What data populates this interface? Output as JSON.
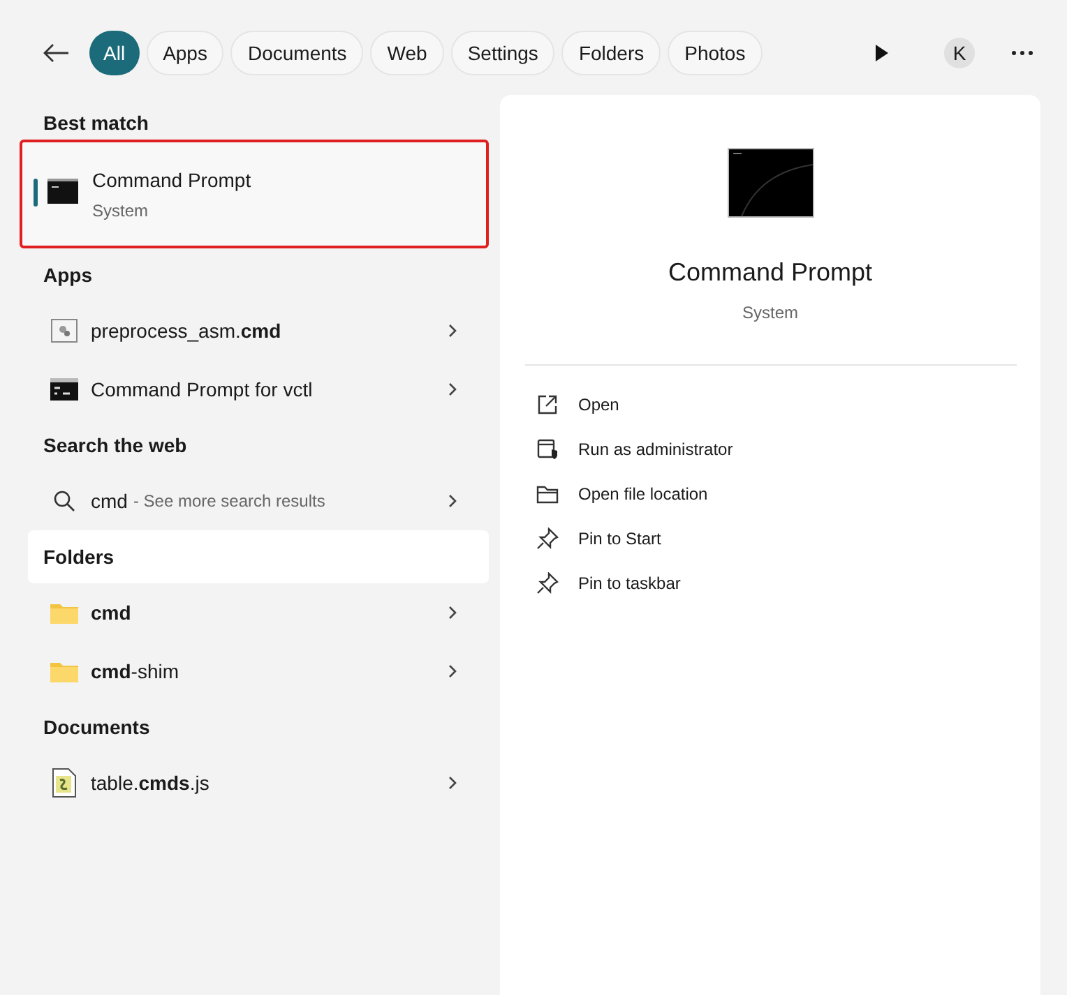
{
  "filters": [
    {
      "label": "All",
      "selected": true
    },
    {
      "label": "Apps",
      "selected": false
    },
    {
      "label": "Documents",
      "selected": false
    },
    {
      "label": "Web",
      "selected": false
    },
    {
      "label": "Settings",
      "selected": false
    },
    {
      "label": "Folders",
      "selected": false
    },
    {
      "label": "Photos",
      "selected": false
    }
  ],
  "account": {
    "initial": "K"
  },
  "best_match": {
    "heading": "Best match",
    "title": "Command Prompt",
    "subtitle": "System",
    "selected": true,
    "outlined": true
  },
  "sections": [
    {
      "heading": "Apps",
      "hovered": false,
      "items": [
        {
          "kind": "script",
          "name": "preprocess_asm.**cmd**"
        },
        {
          "kind": "console",
          "name": "Command Prompt for vctl"
        }
      ]
    },
    {
      "heading": "Search the web",
      "hovered": false,
      "items": [
        {
          "kind": "web",
          "name": "cmd",
          "hint": "- See more search results"
        }
      ]
    },
    {
      "heading": "Folders",
      "hovered": true,
      "items": [
        {
          "kind": "folder",
          "name": "**cmd**"
        },
        {
          "kind": "folder",
          "name": "**cmd**-shim"
        }
      ]
    },
    {
      "heading": "Documents",
      "hovered": false,
      "items": [
        {
          "kind": "jsfile",
          "name": "table.**cmds**.js"
        }
      ]
    }
  ],
  "preview": {
    "title": "Command Prompt",
    "subtitle": "System",
    "actions": [
      {
        "kind": "open",
        "label": "Open"
      },
      {
        "kind": "admin",
        "label": "Run as administrator"
      },
      {
        "kind": "location",
        "label": "Open file location"
      },
      {
        "kind": "pin",
        "label": "Pin to Start"
      },
      {
        "kind": "pin",
        "label": "Pin to taskbar"
      }
    ]
  }
}
